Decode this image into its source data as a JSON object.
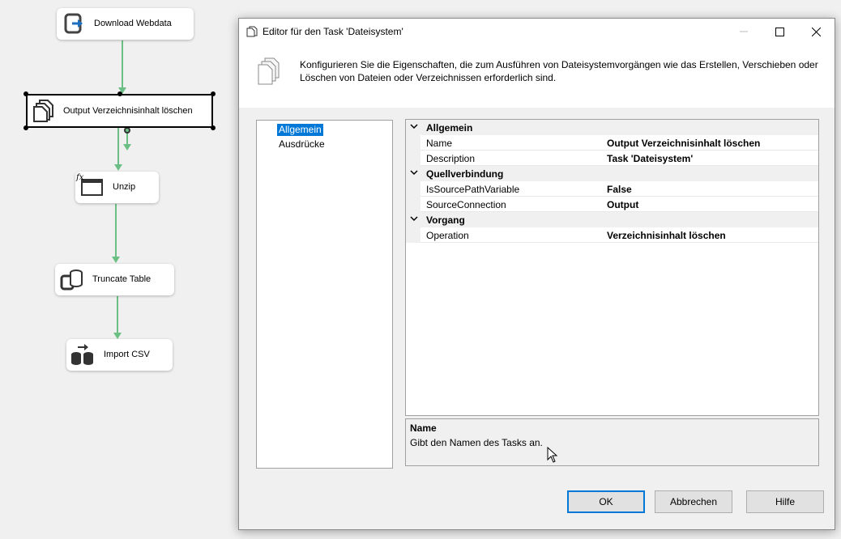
{
  "canvas": {
    "tasks": [
      {
        "label": "Download Webdata",
        "icon": "web-download-icon"
      },
      {
        "label": "Output Verzeichnisinhalt löschen",
        "icon": "file-system-icon"
      },
      {
        "label": "Unzip",
        "icon": "script-task-icon"
      },
      {
        "label": "Truncate Table",
        "icon": "sql-task-icon"
      },
      {
        "label": "Import CSV",
        "icon": "data-flow-icon"
      }
    ]
  },
  "dialog": {
    "title": "Editor für den Task 'Dateisystem'",
    "description": "Konfigurieren Sie die Eigenschaften, die zum Ausführen von Dateisystemvorgängen wie das Erstellen, Verschieben oder Löschen von Dateien oder Verzeichnissen erforderlich sind.",
    "nav": [
      {
        "label": "Allgemein",
        "selected": true
      },
      {
        "label": "Ausdrücke",
        "selected": false
      }
    ],
    "properties": {
      "categories": [
        {
          "name": "Allgemein",
          "items": [
            {
              "name": "Name",
              "value": "Output Verzeichnisinhalt löschen"
            },
            {
              "name": "Description",
              "value": "Task 'Dateisystem'"
            }
          ]
        },
        {
          "name": "Quellverbindung",
          "items": [
            {
              "name": "IsSourcePathVariable",
              "value": "False"
            },
            {
              "name": "SourceConnection",
              "value": "Output"
            }
          ]
        },
        {
          "name": "Vorgang",
          "items": [
            {
              "name": "Operation",
              "value": "Verzeichnisinhalt löschen"
            }
          ]
        }
      ]
    },
    "help": {
      "title": "Name",
      "text": "Gibt den Namen des Tasks an."
    },
    "buttons": {
      "ok": "OK",
      "cancel": "Abbrechen",
      "help": "Hilfe"
    }
  },
  "colors": {
    "accent": "#0078d7",
    "connector": "#6cbf84"
  }
}
